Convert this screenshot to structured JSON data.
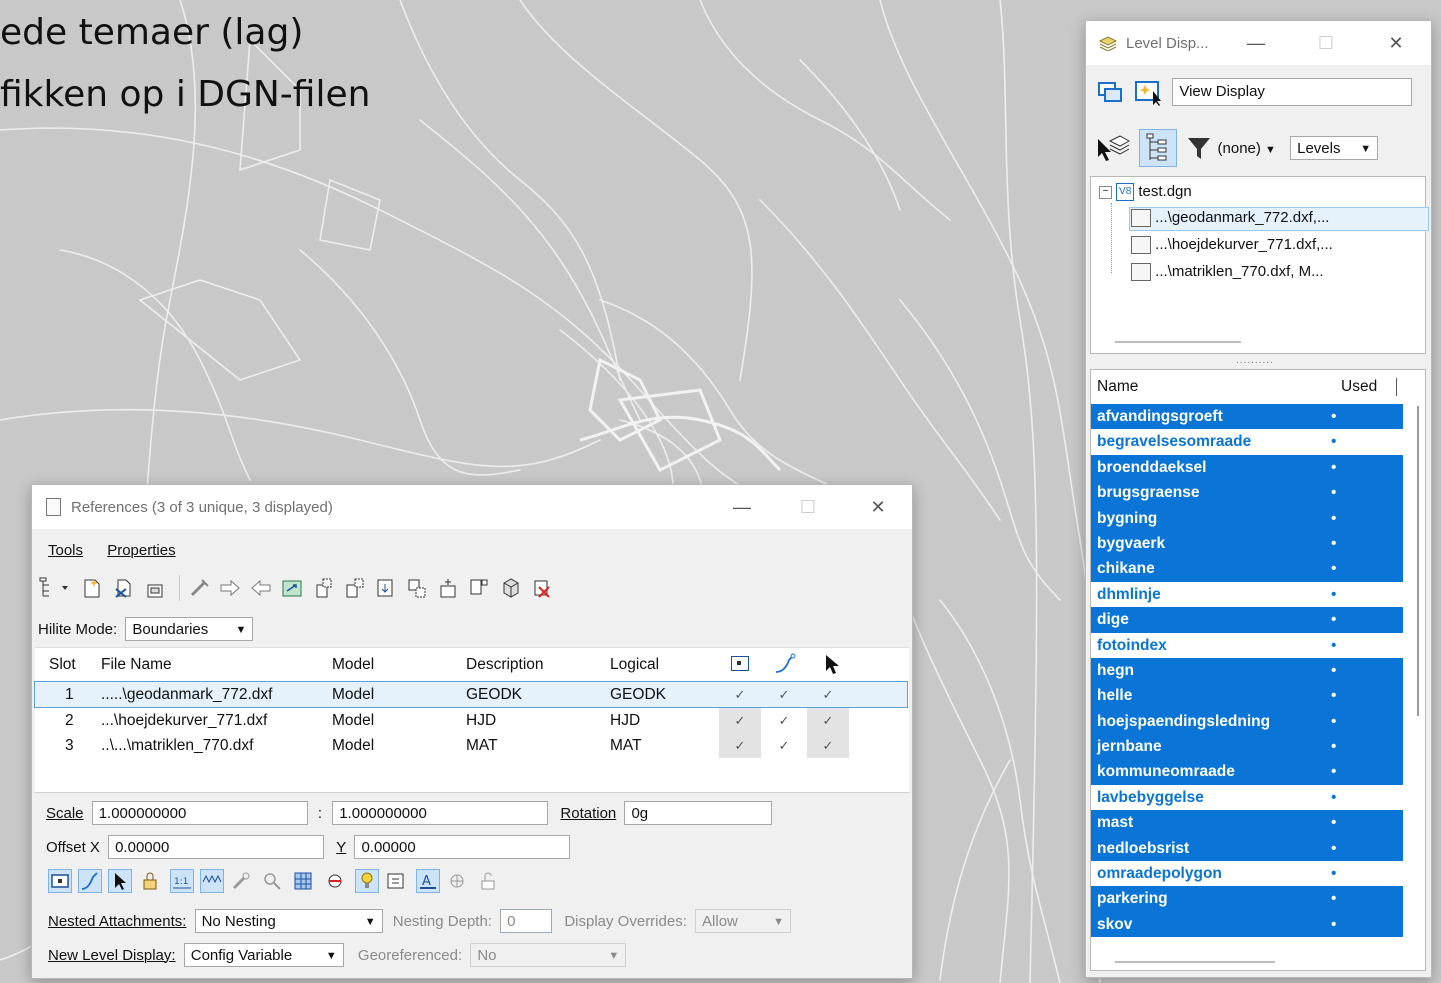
{
  "caption": {
    "line1": "ede temaer (lag)",
    "line2": "fikken op i DGN-filen"
  },
  "level_display": {
    "title": "Level Disp...",
    "view_display_value": "View Display",
    "filter_value": "(none)",
    "mode_value": "Levels",
    "tree": {
      "root": "test.dgn",
      "children": [
        "...\\geodanmark_772.dxf,...",
        "...\\hoejdekurver_771.dxf,...",
        "...\\matriklen_770.dxf, M..."
      ]
    },
    "columns": {
      "name": "Name",
      "used": "Used"
    },
    "splitter": "..........",
    "levels": [
      {
        "name": "afvandingsgroeft",
        "selected": true,
        "used": "•"
      },
      {
        "name": "begravelsesomraade",
        "selected": false,
        "used": "•"
      },
      {
        "name": "broenddaeksel",
        "selected": true,
        "used": "•"
      },
      {
        "name": "brugsgraense",
        "selected": true,
        "used": "•"
      },
      {
        "name": "bygning",
        "selected": true,
        "used": "•"
      },
      {
        "name": "bygvaerk",
        "selected": true,
        "used": "•"
      },
      {
        "name": "chikane",
        "selected": true,
        "used": "•"
      },
      {
        "name": "dhmlinje",
        "selected": false,
        "used": "•"
      },
      {
        "name": "dige",
        "selected": true,
        "used": "•"
      },
      {
        "name": "fotoindex",
        "selected": false,
        "used": "•"
      },
      {
        "name": "hegn",
        "selected": true,
        "used": "•"
      },
      {
        "name": "helle",
        "selected": true,
        "used": "•"
      },
      {
        "name": "hoejspaendingsledning",
        "selected": true,
        "used": "•"
      },
      {
        "name": "jernbane",
        "selected": true,
        "used": "•"
      },
      {
        "name": "kommuneomraade",
        "selected": true,
        "used": "•"
      },
      {
        "name": "lavbebyggelse",
        "selected": false,
        "used": "•"
      },
      {
        "name": "mast",
        "selected": true,
        "used": "•"
      },
      {
        "name": "nedloebsrist",
        "selected": true,
        "used": "•"
      },
      {
        "name": "omraadepolygon",
        "selected": false,
        "used": "•"
      },
      {
        "name": "parkering",
        "selected": true,
        "used": "•"
      },
      {
        "name": "skov",
        "selected": true,
        "used": "•"
      }
    ]
  },
  "references": {
    "title": "References (3 of 3 unique, 3 displayed)",
    "menu": {
      "tools": "Tools",
      "properties": "Properties"
    },
    "hilite_label": "Hilite Mode:",
    "hilite_value": "Boundaries",
    "columns": {
      "slot": "Slot",
      "file": "File Name",
      "model": "Model",
      "description": "Description",
      "logical": "Logical"
    },
    "rows": [
      {
        "slot": "1",
        "file": ".....\\geodanmark_772.dxf",
        "model": "Model",
        "description": "GEODK",
        "logical": "GEODK",
        "c1": "✓",
        "c2": "✓",
        "c3": "✓"
      },
      {
        "slot": "2",
        "file": "...\\hoejdekurver_771.dxf",
        "model": "Model",
        "description": "HJD",
        "logical": "HJD",
        "c1": "✓",
        "c2": "✓",
        "c3": "✓"
      },
      {
        "slot": "3",
        "file": "..\\...\\matriklen_770.dxf",
        "model": "Model",
        "description": "MAT",
        "logical": "MAT",
        "c1": "✓",
        "c2": "✓",
        "c3": "✓"
      }
    ],
    "scale_label": "Scale",
    "scale_1": "1.000000000",
    "scale_sep": ":",
    "scale_2": "1.000000000",
    "rotation_label": "Rotation",
    "rotation_value": "0g",
    "offset_label": "Offset X",
    "offset_x": "0.00000",
    "y_label": "Y",
    "offset_y": "0.00000",
    "nested_label": "Nested Attachments:",
    "nested_value": "No Nesting",
    "depth_label": "Nesting Depth:",
    "depth_value": "0",
    "overrides_label": "Display Overrides:",
    "overrides_value": "Allow",
    "new_level_label": "New Level Display:",
    "new_level_value": "Config Variable",
    "georef_label": "Georeferenced:",
    "georef_value": "No"
  },
  "colors": {
    "selection": "#0a75d6",
    "map_bg": "#c8c8c8",
    "map_lines": "#ececec"
  }
}
